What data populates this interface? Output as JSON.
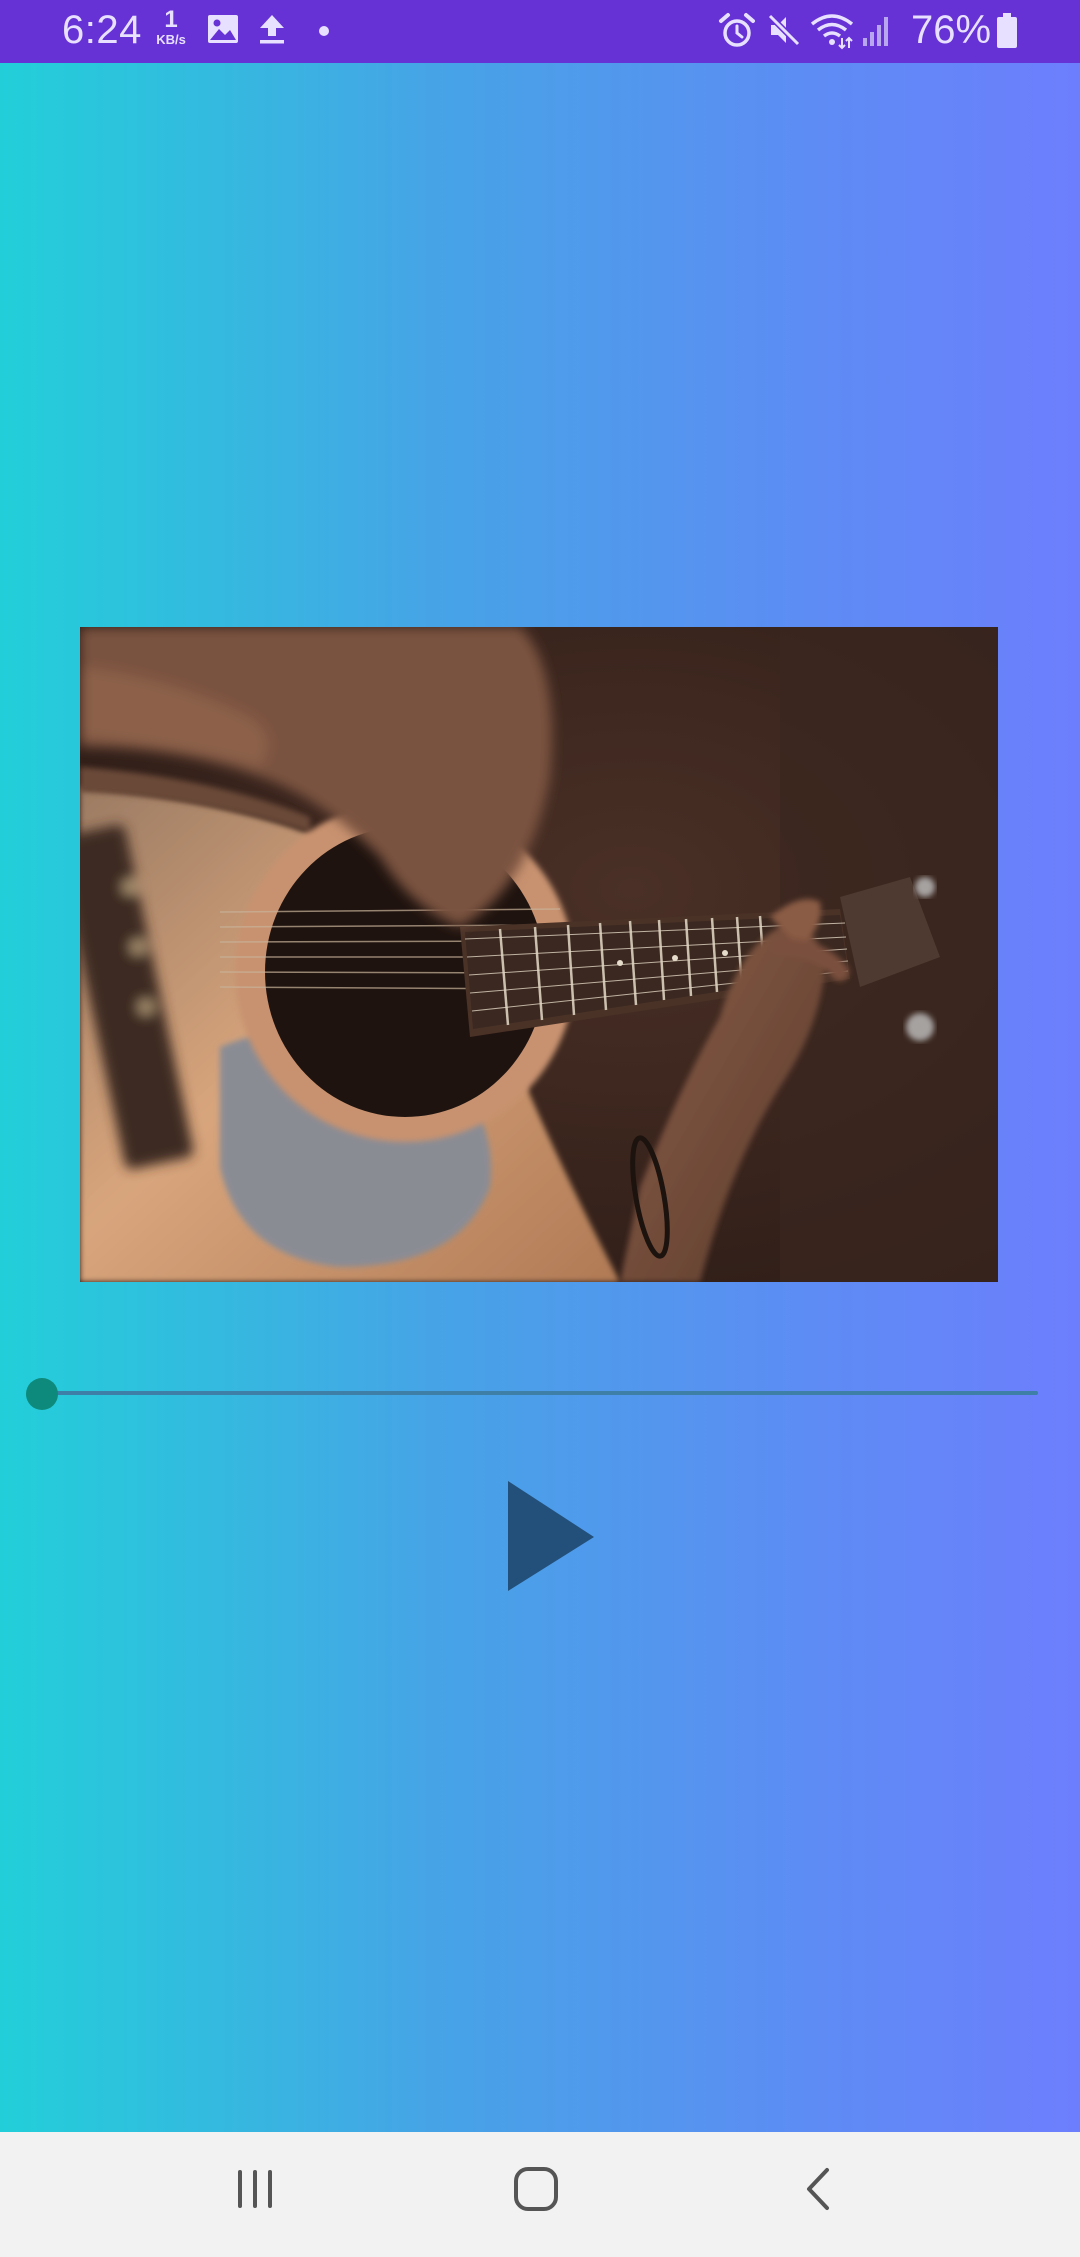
{
  "status_bar": {
    "time": "6:24",
    "net_speed": {
      "value": "1",
      "unit": "KB/s"
    },
    "left_icons": [
      "gallery-icon",
      "upload-icon",
      "notification-dot-icon"
    ],
    "right_icons": [
      "alarm-icon",
      "mute-icon",
      "wifi-icon",
      "signal-icon",
      "battery-icon"
    ],
    "battery_percent": "76%",
    "color": "#6632d6"
  },
  "player": {
    "background_gradient": [
      "#22cfd9",
      "#6d7efd"
    ],
    "album_art": "acoustic-guitar-photo",
    "seek_position": 0,
    "seek_thumb_color": "#0e8a7d",
    "play_icon": "play-icon",
    "play_color": "#22507a"
  },
  "nav_bar": {
    "buttons": [
      "recent-apps-icon",
      "home-icon",
      "back-icon"
    ]
  }
}
